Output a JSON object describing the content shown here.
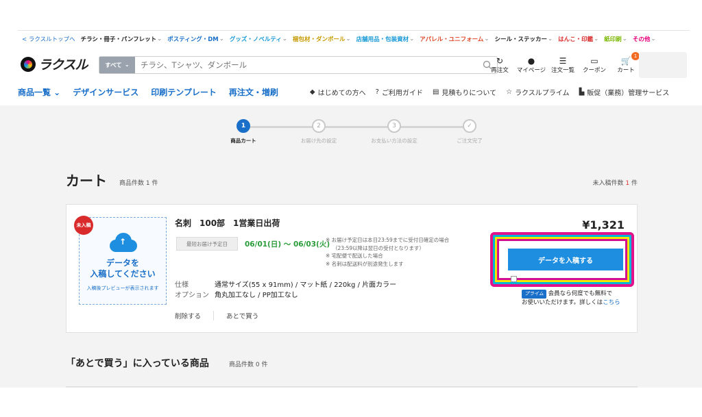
{
  "topbar": {
    "back_link": "< ラクスルトップへ",
    "categories": [
      {
        "label": "チラシ・冊子・パンフレット",
        "color": "#222222"
      },
      {
        "label": "ポスティング・DM",
        "color": "#1a6fc9"
      },
      {
        "label": "グッズ・ノベルティ",
        "color": "#1a9ad6"
      },
      {
        "label": "梱包材・ダンボール",
        "color": "#c89a00"
      },
      {
        "label": "店舗用品・包装資材",
        "color": "#1a9ad6"
      },
      {
        "label": "アパレル・ユニフォーム",
        "color": "#e04a2a"
      },
      {
        "label": "シール・ステッカー",
        "color": "#222222"
      },
      {
        "label": "はんこ・印鑑",
        "color": "#d92b2b"
      },
      {
        "label": "紙印刷",
        "color": "#7ab800"
      },
      {
        "label": "その他",
        "color": "#e6007e"
      }
    ]
  },
  "header": {
    "logo_text": "ラクスル",
    "search_scope": "すべて",
    "search_placeholder": "チラシ、Tシャツ、ダンボール",
    "icons": [
      {
        "name": "reorder-icon",
        "glyph": "↻",
        "label": "再注文"
      },
      {
        "name": "user-icon",
        "glyph": "●",
        "label": "マイページ"
      },
      {
        "name": "order-list-icon",
        "glyph": "☰",
        "label": "注文一覧"
      },
      {
        "name": "coupon-icon",
        "glyph": "▭",
        "label": "クーポン"
      },
      {
        "name": "cart-icon",
        "glyph": "🛒",
        "label": "カート",
        "badge": "1"
      }
    ]
  },
  "nav": {
    "main": [
      "商品一覧 ⌄",
      "デザインサービス",
      "印刷テンプレート",
      "再注文・増刷"
    ],
    "sub": [
      {
        "icon": "shield-icon",
        "glyph": "◆",
        "label": "はじめての方へ"
      },
      {
        "icon": "help-icon",
        "glyph": "?",
        "label": "ご利用ガイド"
      },
      {
        "icon": "estimate-icon",
        "glyph": "▤",
        "label": "見積もりについて"
      },
      {
        "icon": "star-icon",
        "glyph": "☆",
        "label": "ラクスルプライム"
      },
      {
        "icon": "building-icon",
        "glyph": "▙",
        "label": "販促（業務）管理サービス"
      }
    ]
  },
  "steps": [
    {
      "num": "1",
      "label": "商品カート",
      "active": true
    },
    {
      "num": "2",
      "label": "お届け先の設定",
      "active": false
    },
    {
      "num": "3",
      "label": "お支払い方法の設定",
      "active": false
    },
    {
      "num": "✓",
      "label": "ご注文完了",
      "active": false
    }
  ],
  "cart": {
    "title": "カート",
    "count_label": "商品件数 1 件",
    "unsubmitted_label": "未入稿件数",
    "unsubmitted_count": "1",
    "unsubmitted_unit": "件"
  },
  "item": {
    "status_tag": "未入稿",
    "upload_title_1": "データを",
    "upload_title_2": "入稿してください",
    "upload_note": "入稿後プレビューが表示されます",
    "name": "名刺　100部　1営業日出荷",
    "delivery_label": "最短お届け予定日",
    "delivery_value": "06/01(日) 〜 06/03(火)",
    "notes": [
      "※ お届け予定日は本日23:59までに受付日確定の場合",
      "（23:59以降は翌日の受付となります）",
      "※ 宅配便で配送した場合",
      "※ 名刺は配送料が別途発生します"
    ],
    "spec_label": "仕様",
    "spec_value": "通常サイズ(55 x 91mm) / マット紙 / 220kg / 片面カラー",
    "option_label": "オプション",
    "option_value": "角丸加工なし / PP加工なし",
    "delete_label": "削除する",
    "later_label": "あとで買う",
    "price": "¥1,321",
    "submit_button": "データを入稿する",
    "prime_badge": "プライム",
    "prime_text_1": "会員なら何度でも無料で",
    "prime_text_2": "お使いいただけます。詳しくは",
    "prime_link": "こちら"
  },
  "later": {
    "title": "「あとで買う」に入っている商品",
    "count_label": "商品件数 0 件"
  },
  "colors": {
    "accent": "#1a6fc9",
    "button": "#1e8fe0",
    "delivery_green": "#2a9d3a",
    "alert_red": "#d92b2b",
    "highlight_outer": "#e0138c"
  }
}
